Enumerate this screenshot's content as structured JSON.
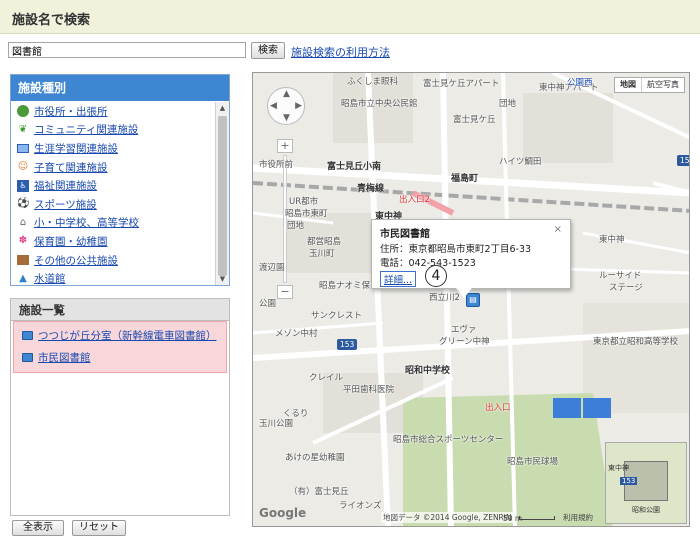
{
  "header": {
    "title": "施設名で検索"
  },
  "search": {
    "value": "図書館",
    "button_label": "検索",
    "help_link": "施設検索の利用方法"
  },
  "categories": {
    "heading": "施設種別",
    "items": [
      {
        "label": "市役所・出張所",
        "icon": "tree-icon"
      },
      {
        "label": "コミュニティ関連施設",
        "icon": "sprout-icon"
      },
      {
        "label": "生涯学習関連施設",
        "icon": "computer-icon"
      },
      {
        "label": "子育て関連施設",
        "icon": "child-icon"
      },
      {
        "label": "福祉関連施設",
        "icon": "wheelchair-icon"
      },
      {
        "label": "スポーツ施設",
        "icon": "soccer-ball-icon"
      },
      {
        "label": "小・中学校、高等学校",
        "icon": "school-icon"
      },
      {
        "label": "保育園・幼稚園",
        "icon": "flower-icon"
      },
      {
        "label": "その他の公共施設",
        "icon": "building-icon"
      },
      {
        "label": "水道館",
        "icon": "water-icon"
      }
    ]
  },
  "facility_list": {
    "heading": "施設一覧",
    "items": [
      {
        "label": "つつじが丘分室（新幹線電車図書館）"
      },
      {
        "label": "市民図書館"
      }
    ]
  },
  "buttons": {
    "show_all": "全表示",
    "reset": "リセット"
  },
  "map": {
    "type_map": "地図",
    "type_satellite": "航空写真",
    "info": {
      "title": "市民図書館",
      "address": "住所：東京都昭島市東町2丁目6-33",
      "phone": "電話：042-543-1523",
      "detail_link": "詳細...",
      "close": "×"
    },
    "callout": "4",
    "credit": "地図データ ©2014 Google, ZENRIN",
    "scale": "50 m",
    "terms": "利用規約",
    "google": "Google",
    "labels": {
      "fukushima": "ふくしま眼科",
      "fujimi_apart": "富士見ケ丘アパート",
      "higashinakagami_apart": "東中神アパート",
      "koenn_nishi": "公園西",
      "akishima_hall": "昭島市立中央公民館",
      "fujimi_north": "富士見ケ丘",
      "danchi": "団地",
      "fujimi_school": "富士見丘小南",
      "haitsu": "ハイツ鯛田",
      "ome_line": "青梅線",
      "akishima_cho": "福島町",
      "exit2": "出入口2",
      "higashinakagami_st": "東中神",
      "kuwazato": "昭島市東町",
      "urtoshi": "UR都市",
      "koen": "公園",
      "akishima_hall2": "都営昭島",
      "tamagawa": "玉川町",
      "sanclest": "サンクレスト",
      "danchi2": "団地",
      "zyuchi": "渡辺園",
      "akishima_naomi": "昭島ナオミ保育",
      "eva": "エヴァ",
      "green_higashi": "グリーン中神",
      "nishi_kawa": "西立川2",
      "showa_kindergarten": "東京都立昭和高等学校",
      "showa_school": "昭和中学校",
      "heiden": "平田歯科医院",
      "exit": "出入口",
      "akishima_sports": "昭島市総合スポーツセンター",
      "akishima_park": "昭島市民球場",
      "kreyl": "クレイル",
      "kuhiru": "くるり",
      "lions": "ライオンズ",
      "tamagawa2": "玉川公園",
      "sakura": "あけの星幼稚園",
      "ota": "（有）富士見丘",
      "ichigo": "市役所前",
      "nakagami_sta": "中神",
      "route153": "153",
      "higashi": "東中神",
      "showa_kinen": "昭和公園",
      "fujimi_side": "ルーサイド",
      "stage": "ステージ",
      "akishima_school": "昭島市立成中学校",
      "mezzon": "メゾン中村"
    },
    "overview_labels": {
      "station": "東中神",
      "park": "昭和公園",
      "route": "153"
    }
  },
  "colors": {
    "accent_blue": "#3e86d2",
    "link_blue": "#1a4ab0",
    "header_bg": "#f1f1dc",
    "list_highlight": "#f8d7da",
    "map_park": "#c8dcb0",
    "map_rail": "#a8a8a8"
  }
}
